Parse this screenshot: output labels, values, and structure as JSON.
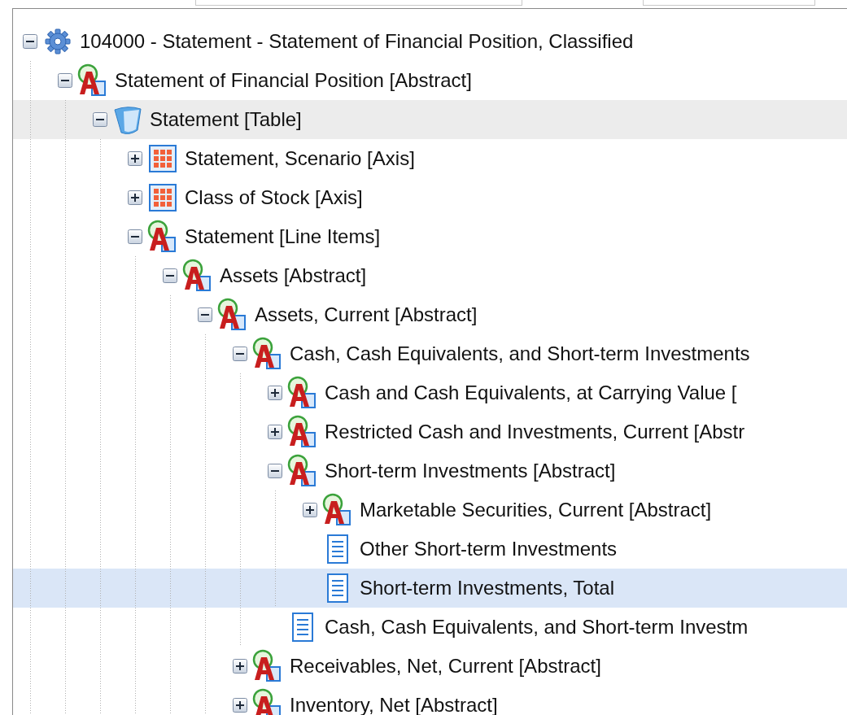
{
  "tree": [
    {
      "label": "104000 - Statement - Statement of Financial Position, Classified",
      "kind": "gear",
      "expanded": true,
      "selected": false,
      "highlighted": false,
      "children": [
        {
          "label": "Statement of Financial Position [Abstract]",
          "kind": "abstract",
          "expanded": true,
          "selected": false,
          "highlighted": false,
          "children": [
            {
              "label": "Statement [Table]",
              "kind": "table",
              "expanded": true,
              "selected": false,
              "highlighted": true,
              "children": [
                {
                  "label": "Statement, Scenario [Axis]",
                  "kind": "axis",
                  "expanded": false,
                  "selected": false,
                  "highlighted": false
                },
                {
                  "label": "Class of Stock [Axis]",
                  "kind": "axis",
                  "expanded": false,
                  "selected": false,
                  "highlighted": false
                },
                {
                  "label": "Statement [Line Items]",
                  "kind": "abstract",
                  "expanded": true,
                  "selected": false,
                  "highlighted": false,
                  "children": [
                    {
                      "label": "Assets [Abstract]",
                      "kind": "abstract",
                      "expanded": true,
                      "selected": false,
                      "highlighted": false,
                      "children": [
                        {
                          "label": "Assets, Current [Abstract]",
                          "kind": "abstract",
                          "expanded": true,
                          "selected": false,
                          "highlighted": false,
                          "children": [
                            {
                              "label": "Cash, Cash Equivalents, and Short-term Investments",
                              "kind": "abstract",
                              "expanded": true,
                              "selected": false,
                              "highlighted": false,
                              "children": [
                                {
                                  "label": "Cash and Cash Equivalents, at Carrying Value [",
                                  "kind": "abstract",
                                  "expanded": false,
                                  "selected": false,
                                  "highlighted": false
                                },
                                {
                                  "label": "Restricted Cash and Investments, Current [Abstr",
                                  "kind": "abstract",
                                  "expanded": false,
                                  "selected": false,
                                  "highlighted": false
                                },
                                {
                                  "label": "Short-term Investments [Abstract]",
                                  "kind": "abstract",
                                  "expanded": true,
                                  "selected": false,
                                  "highlighted": false,
                                  "children": [
                                    {
                                      "label": "Marketable Securities, Current [Abstract]",
                                      "kind": "abstract",
                                      "expanded": false,
                                      "selected": false,
                                      "highlighted": false
                                    },
                                    {
                                      "label": "Other Short-term Investments",
                                      "kind": "element",
                                      "selected": false,
                                      "highlighted": false
                                    },
                                    {
                                      "label": "Short-term Investments, Total",
                                      "kind": "element",
                                      "selected": true,
                                      "highlighted": false
                                    }
                                  ]
                                },
                                {
                                  "label": "Cash, Cash Equivalents, and Short-term Investm",
                                  "kind": "element",
                                  "selected": false,
                                  "highlighted": false
                                }
                              ]
                            },
                            {
                              "label": "Receivables, Net, Current [Abstract]",
                              "kind": "abstract",
                              "expanded": false,
                              "selected": false,
                              "highlighted": false
                            },
                            {
                              "label": "Inventory, Net [Abstract]",
                              "kind": "abstract",
                              "expanded": false,
                              "selected": false,
                              "highlighted": false
                            }
                          ]
                        }
                      ]
                    }
                  ]
                }
              ]
            }
          ]
        }
      ]
    }
  ]
}
